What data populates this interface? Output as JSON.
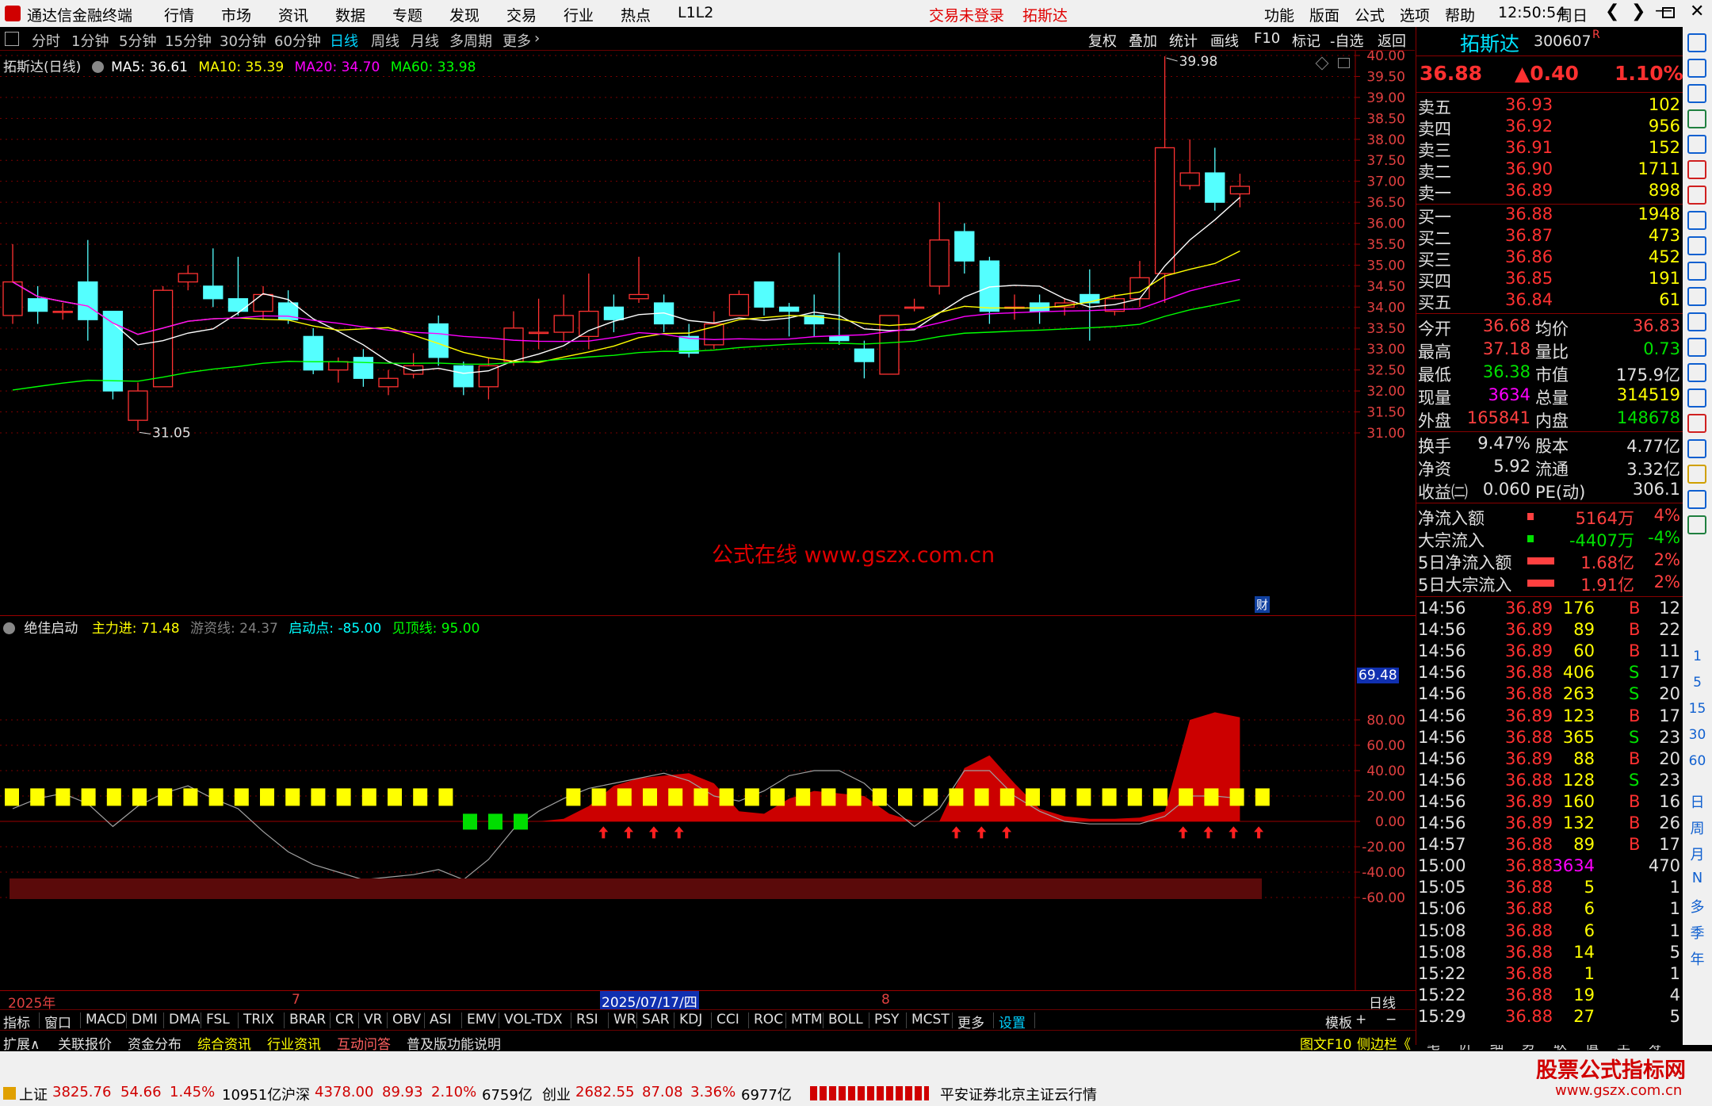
{
  "menubar": {
    "app_title": "通达信金融终端",
    "items": [
      "行情",
      "市场",
      "资讯",
      "数据",
      "专题",
      "发现",
      "交易",
      "行业",
      "热点",
      "L1L2"
    ],
    "login_status": "交易未登录",
    "stock_name": "拓斯达",
    "right_items": [
      "功能",
      "版面",
      "公式",
      "选项",
      "帮助"
    ],
    "time": "12:50:54",
    "weekday": "周日"
  },
  "periodbar": {
    "periods": [
      "分时",
      "1分钟",
      "5分钟",
      "15分钟",
      "30分钟",
      "60分钟",
      "日线",
      "周线",
      "月线",
      "多周期",
      "更多"
    ],
    "active": "日线",
    "right_buttons": [
      "复权",
      "叠加",
      "统计",
      "画线",
      "F10",
      "标记",
      "-自选",
      "返回"
    ]
  },
  "main_chart": {
    "title": "拓斯达(日线)",
    "ma_labels": [
      {
        "text": "MA5: 36.61",
        "color": "#ffffff"
      },
      {
        "text": "MA10: 35.39",
        "color": "#ffff00"
      },
      {
        "text": "MA20: 34.70",
        "color": "#ff00ff"
      },
      {
        "text": "MA60: 33.98",
        "color": "#00ff00"
      }
    ],
    "high_label": "39.98",
    "low_label": "31.05",
    "watermark": "公式在线 www.gszx.com.cn",
    "cai_badge": "财",
    "price_ticks": [
      "40.00",
      "39.50",
      "39.00",
      "38.50",
      "38.00",
      "37.50",
      "37.00",
      "36.50",
      "36.00",
      "35.50",
      "35.00",
      "34.50",
      "34.00",
      "33.50",
      "33.00",
      "32.50",
      "32.00",
      "31.50",
      "31.00"
    ]
  },
  "indicator": {
    "name": "绝佳启动",
    "labels": [
      {
        "text": "主力进: 71.48",
        "color": "#ffff00"
      },
      {
        "text": "游资线: 24.37",
        "color": "#808080"
      },
      {
        "text": "启动点: -85.00",
        "color": "#00ffff"
      },
      {
        "text": "见顶线: 95.00",
        "color": "#00ff00"
      }
    ],
    "current_value": "69.48",
    "ticks": [
      "80.00",
      "60.00",
      "40.00",
      "20.00",
      "0.00",
      "-20.00",
      "-40.00",
      "-60.00"
    ]
  },
  "date_axis": {
    "labels": [
      "2025年",
      "7",
      "2025/07/17/四",
      "8"
    ],
    "period_label": "日线"
  },
  "chart_data": {
    "type": "candlestick",
    "ylim": [
      31.0,
      40.0
    ],
    "candles": [
      {
        "o": 33.8,
        "c": 34.6,
        "h": 35.5,
        "l": 33.6
      },
      {
        "o": 34.2,
        "c": 33.9,
        "h": 34.5,
        "l": 33.6
      },
      {
        "o": 33.9,
        "c": 33.9,
        "h": 34.1,
        "l": 33.7
      },
      {
        "o": 34.6,
        "c": 33.7,
        "h": 35.6,
        "l": 33.2
      },
      {
        "o": 33.9,
        "c": 32.0,
        "h": 33.9,
        "l": 31.8
      },
      {
        "o": 31.3,
        "c": 32.0,
        "h": 32.2,
        "l": 31.05
      },
      {
        "o": 32.1,
        "c": 34.4,
        "h": 34.5,
        "l": 32.1
      },
      {
        "o": 34.6,
        "c": 34.8,
        "h": 35.0,
        "l": 34.4
      },
      {
        "o": 34.5,
        "c": 34.2,
        "h": 35.4,
        "l": 34.0
      },
      {
        "o": 34.2,
        "c": 33.9,
        "h": 35.2,
        "l": 33.8
      },
      {
        "o": 33.9,
        "c": 34.3,
        "h": 34.5,
        "l": 33.7
      },
      {
        "o": 34.1,
        "c": 33.7,
        "h": 34.4,
        "l": 33.6
      },
      {
        "o": 33.3,
        "c": 32.5,
        "h": 33.5,
        "l": 32.4
      },
      {
        "o": 32.5,
        "c": 32.7,
        "h": 32.8,
        "l": 32.2
      },
      {
        "o": 32.8,
        "c": 32.3,
        "h": 33.0,
        "l": 32.1
      },
      {
        "o": 32.1,
        "c": 32.3,
        "h": 32.5,
        "l": 31.9
      },
      {
        "o": 32.4,
        "c": 32.6,
        "h": 32.9,
        "l": 32.3
      },
      {
        "o": 33.6,
        "c": 32.8,
        "h": 33.8,
        "l": 32.6
      },
      {
        "o": 32.6,
        "c": 32.1,
        "h": 32.7,
        "l": 31.9
      },
      {
        "o": 32.1,
        "c": 32.6,
        "h": 32.8,
        "l": 31.8
      },
      {
        "o": 32.7,
        "c": 33.5,
        "h": 33.9,
        "l": 32.6
      },
      {
        "o": 33.4,
        "c": 33.4,
        "h": 34.2,
        "l": 33.0
      },
      {
        "o": 33.4,
        "c": 33.8,
        "h": 34.3,
        "l": 33.2
      },
      {
        "o": 33.3,
        "c": 33.9,
        "h": 34.8,
        "l": 33.0
      },
      {
        "o": 34.0,
        "c": 33.7,
        "h": 34.3,
        "l": 33.4
      },
      {
        "o": 34.2,
        "c": 34.3,
        "h": 35.2,
        "l": 34.1
      },
      {
        "o": 34.1,
        "c": 33.6,
        "h": 34.3,
        "l": 33.4
      },
      {
        "o": 33.3,
        "c": 32.9,
        "h": 33.6,
        "l": 32.8
      },
      {
        "o": 33.1,
        "c": 33.6,
        "h": 33.9,
        "l": 33.0
      },
      {
        "o": 33.8,
        "c": 34.3,
        "h": 34.4,
        "l": 33.8
      },
      {
        "o": 34.6,
        "c": 34.0,
        "h": 34.6,
        "l": 33.8
      },
      {
        "o": 34.0,
        "c": 33.9,
        "h": 34.1,
        "l": 33.3
      },
      {
        "o": 33.8,
        "c": 33.6,
        "h": 34.3,
        "l": 33.3
      },
      {
        "o": 33.3,
        "c": 33.2,
        "h": 35.3,
        "l": 33.1
      },
      {
        "o": 33.0,
        "c": 32.7,
        "h": 33.2,
        "l": 32.3
      },
      {
        "o": 32.4,
        "c": 33.8,
        "h": 33.8,
        "l": 32.4
      },
      {
        "o": 34.0,
        "c": 34.0,
        "h": 34.2,
        "l": 33.9
      },
      {
        "o": 34.5,
        "c": 35.6,
        "h": 36.5,
        "l": 34.3
      },
      {
        "o": 35.8,
        "c": 35.1,
        "h": 36.0,
        "l": 34.8
      },
      {
        "o": 35.1,
        "c": 33.9,
        "h": 35.2,
        "l": 33.6
      },
      {
        "o": 34.0,
        "c": 34.0,
        "h": 34.3,
        "l": 33.7
      },
      {
        "o": 34.1,
        "c": 33.9,
        "h": 34.3,
        "l": 33.6
      },
      {
        "o": 34.0,
        "c": 34.1,
        "h": 34.2,
        "l": 33.8
      },
      {
        "o": 34.3,
        "c": 34.1,
        "h": 34.9,
        "l": 33.2
      },
      {
        "o": 33.9,
        "c": 34.2,
        "h": 34.3,
        "l": 33.8
      },
      {
        "o": 34.2,
        "c": 34.7,
        "h": 35.1,
        "l": 34.0
      },
      {
        "o": 34.8,
        "c": 37.8,
        "h": 39.98,
        "l": 34.1
      },
      {
        "o": 36.9,
        "c": 37.2,
        "h": 38.0,
        "l": 36.8
      },
      {
        "o": 37.2,
        "c": 36.5,
        "h": 37.8,
        "l": 36.3
      },
      {
        "o": 36.7,
        "c": 36.88,
        "h": 37.18,
        "l": 36.38
      }
    ]
  },
  "quote": {
    "name": "拓斯达",
    "code": "300607",
    "badge": "R",
    "price": "36.88",
    "change": "▲0.40",
    "change_pct": "1.10%",
    "sell": [
      {
        "label": "卖五",
        "price": "36.93",
        "vol": "102"
      },
      {
        "label": "卖四",
        "price": "36.92",
        "vol": "956"
      },
      {
        "label": "卖三",
        "price": "36.91",
        "vol": "152"
      },
      {
        "label": "卖二",
        "price": "36.90",
        "vol": "1711"
      },
      {
        "label": "卖一",
        "price": "36.89",
        "vol": "898"
      }
    ],
    "buy": [
      {
        "label": "买一",
        "price": "36.88",
        "vol": "1948"
      },
      {
        "label": "买二",
        "price": "36.87",
        "vol": "473"
      },
      {
        "label": "买三",
        "price": "36.86",
        "vol": "452"
      },
      {
        "label": "买四",
        "price": "36.85",
        "vol": "191"
      },
      {
        "label": "买五",
        "price": "36.84",
        "vol": "61"
      }
    ],
    "stats": [
      {
        "l1": "今开",
        "v1": "36.68",
        "c1": "#ff4040",
        "l2": "均价",
        "v2": "36.83",
        "c2": "#ff4040"
      },
      {
        "l1": "最高",
        "v1": "37.18",
        "c1": "#ff4040",
        "l2": "量比",
        "v2": "0.73",
        "c2": "#00e000"
      },
      {
        "l1": "最低",
        "v1": "36.38",
        "c1": "#00e000",
        "l2": "市值",
        "v2": "175.9亿",
        "c2": "#e0e0e0"
      },
      {
        "l1": "现量",
        "v1": "3634",
        "c1": "#ff00ff",
        "l2": "总量",
        "v2": "314519",
        "c2": "#ffff00"
      },
      {
        "l1": "外盘",
        "v1": "165841",
        "c1": "#ff4040",
        "l2": "内盘",
        "v2": "148678",
        "c2": "#00e000"
      }
    ],
    "stats2": [
      {
        "l1": "换手",
        "v1": "9.47%",
        "l2": "股本",
        "v2": "4.77亿"
      },
      {
        "l1": "净资",
        "v1": "5.92",
        "l2": "流通",
        "v2": "3.32亿"
      },
      {
        "l1": "收益㈡",
        "v1": "0.060",
        "l2": "PE(动)",
        "v2": "306.1"
      }
    ],
    "flows": [
      {
        "label": "净流入额",
        "value": "5164万",
        "pct": "4%",
        "color": "#ff4040",
        "bar": 8
      },
      {
        "label": "大宗流入",
        "value": "-4407万",
        "pct": "-4%",
        "color": "#00e000",
        "bar": 8
      },
      {
        "label": "5日净流入额",
        "value": "1.68亿",
        "pct": "2%",
        "color": "#ff4040",
        "bar": 34
      },
      {
        "label": "5日大宗流入",
        "value": "1.91亿",
        "pct": "2%",
        "color": "#ff4040",
        "bar": 34
      }
    ],
    "ticks": [
      {
        "t": "14:56",
        "p": "36.89",
        "v": "176",
        "bs": "B",
        "n": "12"
      },
      {
        "t": "14:56",
        "p": "36.89",
        "v": "89",
        "bs": "B",
        "n": "22"
      },
      {
        "t": "14:56",
        "p": "36.89",
        "v": "60",
        "bs": "B",
        "n": "11"
      },
      {
        "t": "14:56",
        "p": "36.88",
        "v": "406",
        "bs": "S",
        "n": "17"
      },
      {
        "t": "14:56",
        "p": "36.88",
        "v": "263",
        "bs": "S",
        "n": "20"
      },
      {
        "t": "14:56",
        "p": "36.89",
        "v": "123",
        "bs": "B",
        "n": "17"
      },
      {
        "t": "14:56",
        "p": "36.88",
        "v": "365",
        "bs": "S",
        "n": "23"
      },
      {
        "t": "14:56",
        "p": "36.89",
        "v": "88",
        "bs": "B",
        "n": "20"
      },
      {
        "t": "14:56",
        "p": "36.88",
        "v": "128",
        "bs": "S",
        "n": "23"
      },
      {
        "t": "14:56",
        "p": "36.89",
        "v": "160",
        "bs": "B",
        "n": "16"
      },
      {
        "t": "14:56",
        "p": "36.89",
        "v": "132",
        "bs": "B",
        "n": "26"
      },
      {
        "t": "14:57",
        "p": "36.88",
        "v": "89",
        "bs": "B",
        "n": "17"
      },
      {
        "t": "15:00",
        "p": "36.88",
        "v": "3634",
        "bs": "",
        "n": "470"
      },
      {
        "t": "15:05",
        "p": "36.88",
        "v": "5",
        "bs": "",
        "n": "1"
      },
      {
        "t": "15:06",
        "p": "36.88",
        "v": "6",
        "bs": "",
        "n": "1"
      },
      {
        "t": "15:08",
        "p": "36.88",
        "v": "6",
        "bs": "",
        "n": "1"
      },
      {
        "t": "15:08",
        "p": "36.88",
        "v": "14",
        "bs": "",
        "n": "5"
      },
      {
        "t": "15:22",
        "p": "36.88",
        "v": "1",
        "bs": "",
        "n": "1"
      },
      {
        "t": "15:22",
        "p": "36.88",
        "v": "19",
        "bs": "",
        "n": "4"
      },
      {
        "t": "15:29",
        "p": "36.88",
        "v": "27",
        "bs": "",
        "n": "5"
      }
    ],
    "bottom_tabs": [
      "笔",
      "价",
      "细",
      "势",
      "联",
      "值",
      "主",
      "筹"
    ]
  },
  "vtool_side_labels": [
    "日",
    "周",
    "月",
    "N",
    "多",
    "季",
    "年"
  ],
  "vtool_numbers": [
    "1",
    "5",
    "15",
    "30",
    "60"
  ],
  "indicator_tabs": [
    "指标",
    "窗口",
    "MACD",
    "DMI",
    "DMA",
    "FSL",
    "TRIX",
    "BRAR",
    "CR",
    "VR",
    "OBV",
    "ASI",
    "EMV",
    "VOL-TDX",
    "RSI",
    "WR",
    "SAR",
    "KDJ",
    "CCI",
    "ROC",
    "MTM",
    "BOLL",
    "PSY",
    "MCST",
    "更多",
    "设置"
  ],
  "indicator_tabs_right": [
    "模板",
    "+",
    "−"
  ],
  "info_tabs": [
    {
      "text": "扩展∧",
      "color": "#e0e0e0"
    },
    {
      "text": "关联报价",
      "color": "#e0e0e0"
    },
    {
      "text": "资金分布",
      "color": "#e0e0e0"
    },
    {
      "text": "综合资讯",
      "color": "#ffff00"
    },
    {
      "text": "行业资讯",
      "color": "#ffff00"
    },
    {
      "text": "互动问答",
      "color": "#ff6060"
    },
    {
      "text": "普及版功能说明",
      "color": "#e0e0e0"
    }
  ],
  "info_tabs_right": [
    "图文F10",
    "侧边栏《"
  ],
  "statusbar": {
    "sh": {
      "name": "上证",
      "value": "3825.76",
      "chg": "54.66",
      "pct": "1.45%",
      "amt": "10951亿"
    },
    "hs": {
      "name": "沪深",
      "value": "4378.00",
      "chg": "89.93",
      "pct": "2.10%",
      "amt": "6759亿"
    },
    "cy": {
      "name": "创业",
      "value": "2682.55",
      "chg": "87.08",
      "pct": "3.36%",
      "amt": "6977亿"
    },
    "broker": "平安证券北京主证云行情",
    "logo_title": "股票公式指标网",
    "logo_url": "www.gszx.com.cn"
  }
}
